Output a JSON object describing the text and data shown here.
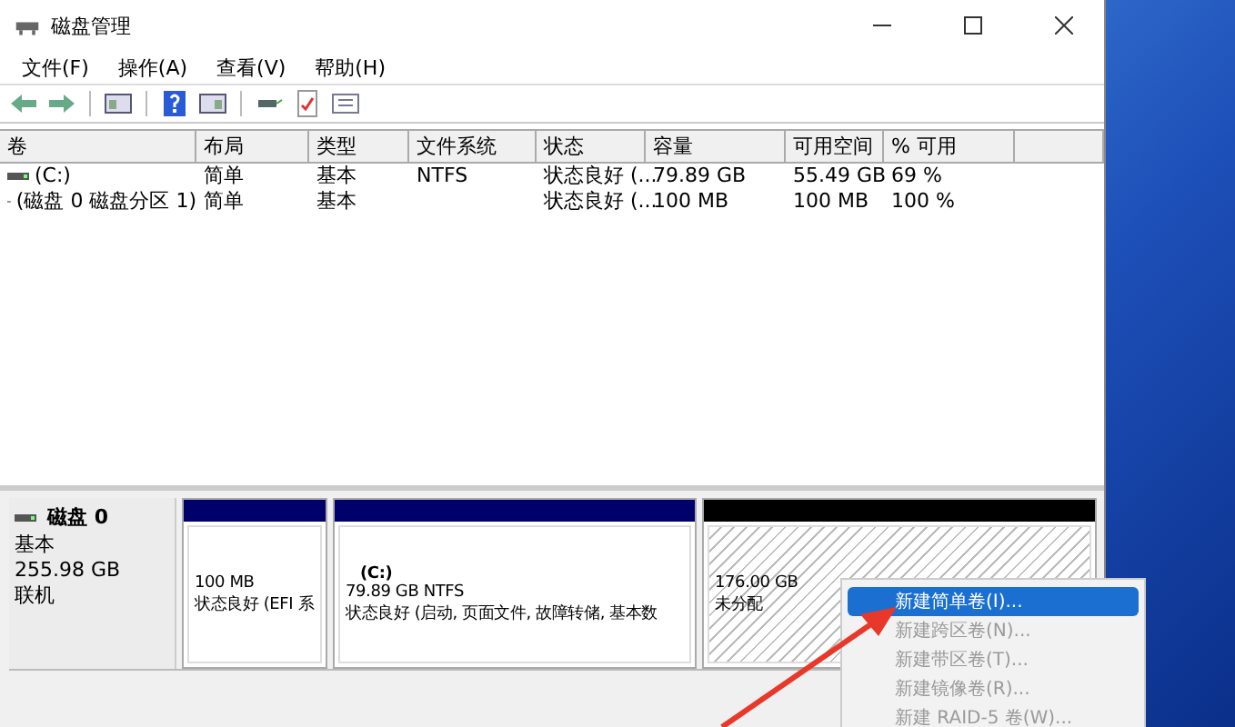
{
  "window": {
    "title": "磁盘管理"
  },
  "menu": [
    "文件(F)",
    "操作(A)",
    "查看(V)",
    "帮助(H)"
  ],
  "table": {
    "columns": [
      "卷",
      "布局",
      "类型",
      "文件系统",
      "状态",
      "容量",
      "可用空间",
      "% 可用"
    ],
    "rows": [
      [
        "(C:)",
        "简单",
        "基本",
        "NTFS",
        "状态良好 (...",
        "79.89 GB",
        "55.49 GB",
        "69 %"
      ],
      [
        "(磁盘 0 磁盘分区 1)",
        "简单",
        "基本",
        "",
        "状态良好 (...",
        "100 MB",
        "100 MB",
        "100 %"
      ]
    ]
  },
  "disk": {
    "name": "磁盘 0",
    "type": "基本",
    "size": "255.98 GB",
    "status": "联机",
    "partitions": [
      {
        "kind": "primary",
        "size": "100 MB",
        "status": "状态良好 (EFI 系"
      },
      {
        "kind": "primary",
        "label": "(C:)",
        "size": "79.89 GB NTFS",
        "status": "状态良好 (启动, 页面文件, 故障转储, 基本数"
      },
      {
        "kind": "unallocated",
        "size": "176.00 GB",
        "status": "未分配"
      }
    ]
  },
  "context_menu": [
    {
      "label": "新建简单卷(I)...",
      "selected": true,
      "disabled": false
    },
    {
      "label": "新建跨区卷(N)...",
      "selected": false,
      "disabled": true
    },
    {
      "label": "新建带区卷(T)...",
      "selected": false,
      "disabled": true
    },
    {
      "label": "新建镜像卷(R)...",
      "selected": false,
      "disabled": true
    },
    {
      "label": "新建 RAID-5 卷(W)...",
      "selected": false,
      "disabled": true
    }
  ]
}
